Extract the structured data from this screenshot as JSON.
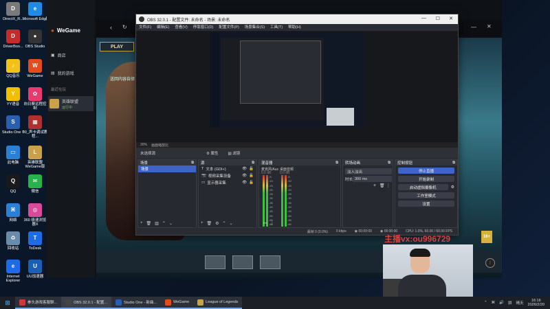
{
  "desktop": {
    "icons": [
      {
        "label": "DirectX_R...",
        "color": "#7a7a7a",
        "glyph": "D"
      },
      {
        "label": "Microsoft Edge",
        "color": "#1f8be6",
        "glyph": "e"
      },
      {
        "label": "腾讯电脑管家",
        "color": "#1b6ee0",
        "glyph": "✓"
      },
      {
        "label": "DriverBoo...",
        "color": "#c42b2b",
        "glyph": "D"
      },
      {
        "label": "OBS Studio",
        "color": "#333",
        "glyph": "●"
      },
      {
        "label": "QQ音乐",
        "color": "#f2c21b",
        "glyph": "♪"
      },
      {
        "label": "WeGame",
        "color": "#e14b1e",
        "glyph": "W"
      },
      {
        "label": "YY语音",
        "color": "#f0c000",
        "glyph": "Y"
      },
      {
        "label": "向日葵远程控制",
        "color": "#e83a6e",
        "glyph": "✿"
      },
      {
        "label": "Studio One 7",
        "color": "#2a5fb0",
        "glyph": "S"
      },
      {
        "label": "00_声卡调试教程...",
        "color": "#b03030",
        "glyph": "▦"
      },
      {
        "label": "此电脑",
        "color": "#2b7fd4",
        "glyph": "▭"
      },
      {
        "label": "英雄联盟WeGame版",
        "color": "#c8a14a",
        "glyph": "L"
      },
      {
        "label": "QQ",
        "color": "#1a1a1a",
        "glyph": "Q"
      },
      {
        "label": "微信",
        "color": "#27b24a",
        "glyph": "✉"
      },
      {
        "label": "网络",
        "color": "#2b7fd4",
        "glyph": "⌘"
      },
      {
        "label": "360 极速浏览器X",
        "color": "#d94a9b",
        "glyph": "◎"
      },
      {
        "label": "回收站",
        "color": "#6a8cab",
        "glyph": "♻"
      },
      {
        "label": "ToDesk",
        "color": "#1e6be6",
        "glyph": "T"
      },
      {
        "label": "Internet Explorer",
        "color": "#1e6be6",
        "glyph": "e"
      },
      {
        "label": "UU加速器",
        "color": "#1b5fb4",
        "glyph": "U"
      }
    ]
  },
  "wegame": {
    "logo": "WeGame",
    "nav": [
      {
        "label": "商店"
      },
      {
        "label": "我的游戏"
      }
    ],
    "recent_label": "最近在玩",
    "game_name": "英雄联盟",
    "game_status": "运行中",
    "play_label": "PLAY",
    "news_headline": "送回内容自律",
    "hextech_label": "16+"
  },
  "obs": {
    "title": "OBS 32.0.1 - 配置文件: 未命名 - 场景: 未命名",
    "menu": [
      "文件(F)",
      "编辑(E)",
      "查看(V)",
      "停靠窗口(D)",
      "配置文件(P)",
      "场景集合(S)",
      "工具(T)",
      "帮助(H)"
    ],
    "zoom": "30%",
    "canvas_label": "画面缩放比",
    "no_source": "未选择源",
    "properties_label": "属性",
    "filters_label": "滤镜",
    "docks": {
      "scenes": {
        "title": "场景",
        "items": [
          "场景"
        ]
      },
      "sources": {
        "title": "源",
        "items": [
          {
            "label": "文本 (GDI+)",
            "icon": "text-icon"
          },
          {
            "label": "视频采集设备",
            "icon": "camera-icon"
          },
          {
            "label": "显示器采集",
            "icon": "monitor-icon"
          }
        ]
      },
      "mixer": {
        "title": "混音器",
        "channels": [
          {
            "name": "麦克风/Aux",
            "db": "0.0 dB"
          },
          {
            "name": "桌面音频",
            "db": "0.0 dB"
          }
        ],
        "scale": [
          "-5",
          "-10",
          "-15",
          "-20",
          "-25",
          "-30",
          "-35",
          "-40",
          "-45",
          "-50",
          "-55",
          "-60"
        ]
      },
      "transitions": {
        "title": "转场动画",
        "type": "淡入淡出",
        "duration_label": "时长",
        "duration": "300 ms"
      },
      "controls": {
        "title": "控制按钮",
        "buttons": [
          {
            "label": "停止直播",
            "active": true
          },
          {
            "label": "开始录制",
            "active": false
          },
          {
            "label": "启动虚拟摄像机",
            "active": false
          },
          {
            "label": "工作室模式",
            "active": false
          },
          {
            "label": "设置",
            "active": false
          }
        ]
      }
    },
    "status": {
      "dropped": "丢帧 0 (0.0%)",
      "bitrate": "0 kbps",
      "live": "00:00:00",
      "rec": "00:00:00",
      "cpu": "CPU: 1.0%, 60.00 / 60.00 FPS"
    }
  },
  "stream_overlay": "主播vx:ou996729",
  "taskbar": {
    "apps": [
      {
        "label": "拳头游戏客服聊...",
        "color": "#c93a3a",
        "state": "on"
      },
      {
        "label": "OBS 32.0.1 - 配置...",
        "color": "#444",
        "state": "sel"
      },
      {
        "label": "Studio One - 新曲...",
        "color": "#2a5fb0",
        "state": "on"
      },
      {
        "label": "WeGame",
        "color": "#e14b1e",
        "state": "on"
      },
      {
        "label": "League of Legends",
        "color": "#c8a14a",
        "state": "on"
      }
    ],
    "tray_lang": "拼",
    "time": "16:16",
    "date": "2026/2/20",
    "weather": "晴天"
  }
}
